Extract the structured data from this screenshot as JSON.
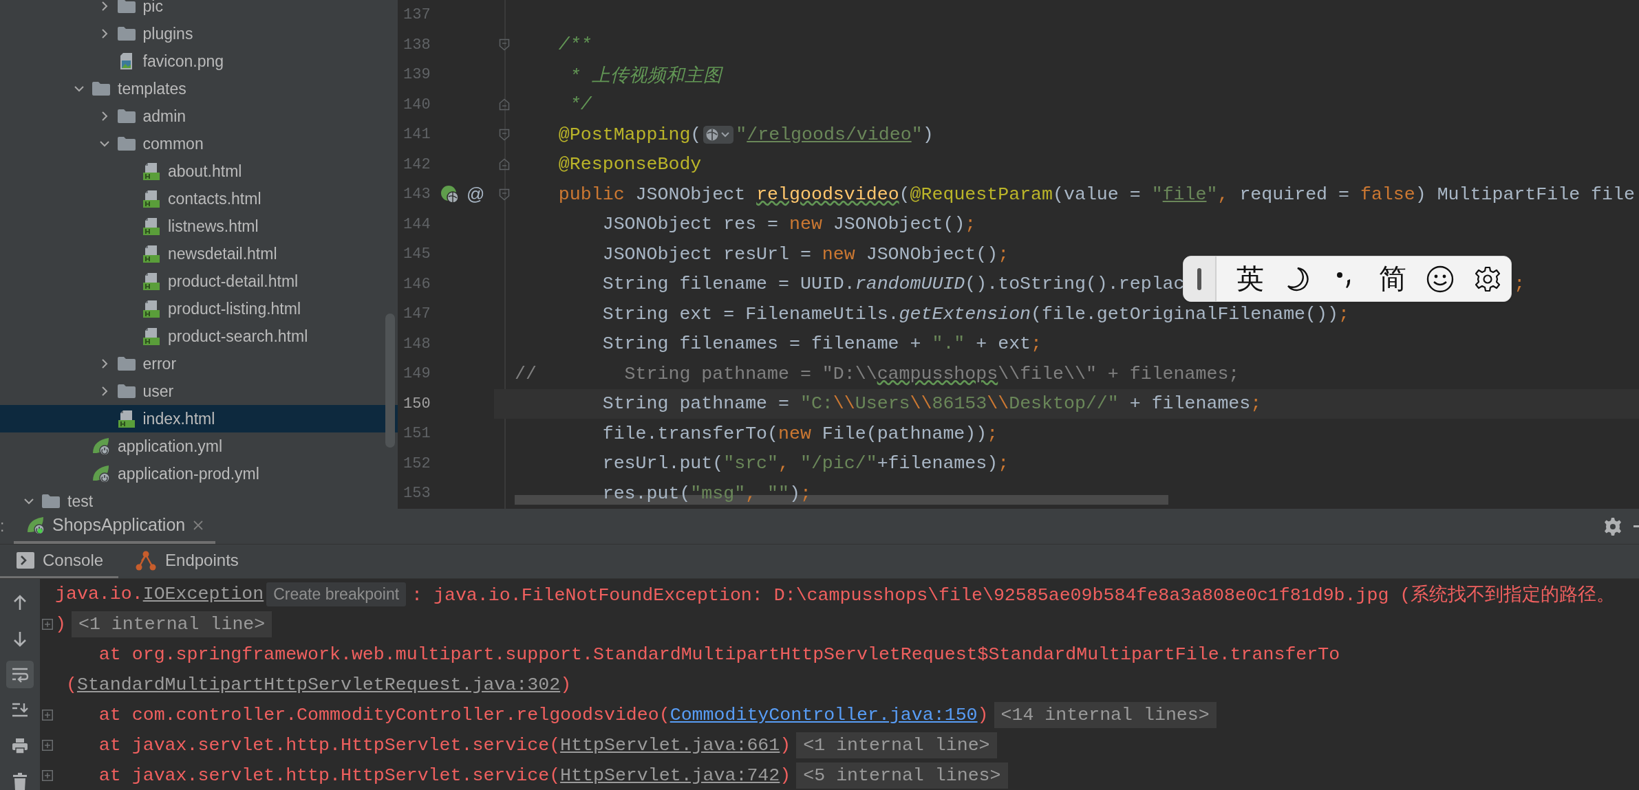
{
  "tree": {
    "items": [
      {
        "children": [
          {
            "children": [
              {
                "children": [
                  {
                    "label": "pic",
                    "kind": "folder",
                    "expanded": false,
                    "selected": false
                  },
                  {
                    "label": "plugins",
                    "kind": "folder",
                    "expanded": false,
                    "selected": false
                  },
                  {
                    "label": "favicon.png",
                    "kind": "image",
                    "selected": false
                  }
                ]
              },
              {
                "label": "templates",
                "kind": "folder",
                "expanded": true,
                "selected": false,
                "children": [
                  {
                    "label": "admin",
                    "kind": "folder",
                    "expanded": false,
                    "selected": false
                  },
                  {
                    "label": "common",
                    "kind": "folder",
                    "expanded": true,
                    "selected": false,
                    "children": [
                      {
                        "label": "about.html",
                        "kind": "html",
                        "selected": false
                      },
                      {
                        "label": "contacts.html",
                        "kind": "html",
                        "selected": false
                      },
                      {
                        "label": "listnews.html",
                        "kind": "html",
                        "selected": false
                      },
                      {
                        "label": "newsdetail.html",
                        "kind": "html",
                        "selected": false
                      },
                      {
                        "label": "product-detail.html",
                        "kind": "html",
                        "selected": false
                      },
                      {
                        "label": "product-listing.html",
                        "kind": "html",
                        "selected": false
                      },
                      {
                        "label": "product-search.html",
                        "kind": "html",
                        "selected": false
                      }
                    ]
                  },
                  {
                    "label": "error",
                    "kind": "folder",
                    "expanded": false,
                    "selected": false
                  },
                  {
                    "label": "user",
                    "kind": "folder",
                    "expanded": false,
                    "selected": false
                  },
                  {
                    "label": "index.html",
                    "kind": "html",
                    "selected": true
                  }
                ]
              },
              {
                "label": "application.yml",
                "kind": "yml",
                "selected": false
              },
              {
                "label": "application-prod.yml",
                "kind": "yml",
                "selected": false
              }
            ]
          }
        ]
      },
      {
        "label": "test",
        "kind": "folder",
        "expanded": true,
        "selected": false
      }
    ]
  },
  "editor": {
    "lines": [
      {
        "number": "137",
        "current": false
      },
      {
        "number": "138",
        "current": false,
        "fold": {
          "kind": "start"
        },
        "tokens": [
          {
            "kind": "doc",
            "text": "    /**"
          }
        ]
      },
      {
        "number": "139",
        "current": false,
        "tokens": [
          {
            "kind": "doc",
            "text": "     * 上传视频和主图"
          }
        ]
      },
      {
        "number": "140",
        "current": false,
        "fold": {
          "kind": "end"
        },
        "tokens": [
          {
            "kind": "doc",
            "text": "     */"
          }
        ]
      },
      {
        "number": "141",
        "current": false,
        "fold": {
          "kind": "start"
        },
        "tokens": [
          {
            "kind": "annotation",
            "text": "    @PostMapping"
          },
          {
            "kind": "plain",
            "text": "("
          },
          {
            "kind": "icon"
          },
          {
            "kind": "string",
            "text": "\""
          },
          {
            "kind": "string-ref",
            "text": "/relgoods/video"
          },
          {
            "kind": "string",
            "text": "\""
          },
          {
            "kind": "plain",
            "text": ")"
          }
        ]
      },
      {
        "number": "142",
        "current": false,
        "fold": {
          "kind": "end"
        },
        "tokens": [
          {
            "kind": "annotation",
            "text": "    @ResponseBody"
          }
        ]
      },
      {
        "number": "143",
        "current": false,
        "fold": {
          "kind": "start"
        },
        "markers": [
          {
            "kind": "bean"
          },
          {
            "kind": "text",
            "text": "@"
          }
        ],
        "tokens": [
          {
            "kind": "keyword",
            "text": "    public "
          },
          {
            "kind": "plain",
            "text": "JSONObject "
          },
          {
            "kind": "method",
            "text": "relgoodsvideo"
          },
          {
            "kind": "plain",
            "text": "("
          },
          {
            "kind": "annotation",
            "text": "@RequestParam"
          },
          {
            "kind": "plain",
            "text": "(value = "
          },
          {
            "kind": "string",
            "text": "\""
          },
          {
            "kind": "string-ref",
            "text": "file"
          },
          {
            "kind": "string",
            "text": "\""
          },
          {
            "kind": "keyword",
            "text": ", "
          },
          {
            "kind": "plain",
            "text": "required = "
          },
          {
            "kind": "keyword",
            "text": "false"
          },
          {
            "kind": "plain",
            "text": ") MultipartFile file"
          }
        ]
      },
      {
        "number": "144",
        "current": false,
        "tokens": [
          {
            "kind": "plain",
            "text": "        JSONObject res = "
          },
          {
            "kind": "keyword",
            "text": "new "
          },
          {
            "kind": "plain",
            "text": "JSONObject()"
          },
          {
            "kind": "keyword",
            "text": ";"
          }
        ]
      },
      {
        "number": "145",
        "current": false,
        "tokens": [
          {
            "kind": "plain",
            "text": "        JSONObject resUrl = "
          },
          {
            "kind": "keyword",
            "text": "new "
          },
          {
            "kind": "plain",
            "text": "JSONObject()"
          },
          {
            "kind": "keyword",
            "text": ";"
          }
        ]
      },
      {
        "number": "146",
        "current": false,
        "tokens": [
          {
            "kind": "plain",
            "text": "        String filename = UUID."
          },
          {
            "kind": "static",
            "text": "randomUUID"
          },
          {
            "kind": "plain",
            "text": "().toString().replac"
          },
          {
            "kind": "tail",
            "text": ";"
          }
        ]
      },
      {
        "number": "147",
        "current": false,
        "tokens": [
          {
            "kind": "plain",
            "text": "        String ext = FilenameUtils."
          },
          {
            "kind": "static",
            "text": "getExtension"
          },
          {
            "kind": "plain",
            "text": "(file.getOriginalFilename())"
          },
          {
            "kind": "keyword",
            "text": ";"
          }
        ]
      },
      {
        "number": "148",
        "current": false,
        "tokens": [
          {
            "kind": "plain",
            "text": "        String filenames = filename + "
          },
          {
            "kind": "string",
            "text": "\".\""
          },
          {
            "kind": "plain",
            "text": " + ext"
          },
          {
            "kind": "keyword",
            "text": ";"
          }
        ]
      },
      {
        "number": "149",
        "current": false,
        "tokens": [
          {
            "kind": "comment",
            "text": "//        String pathname = \"D:\\\\"
          },
          {
            "kind": "comment-typo",
            "text": "campusshops"
          },
          {
            "kind": "comment",
            "text": "\\\\file\\\\\" + filenames;"
          }
        ]
      },
      {
        "number": "150",
        "current": true,
        "tokens": [
          {
            "kind": "plain",
            "text": "        String pathname = "
          },
          {
            "kind": "string",
            "text": "\"C:"
          },
          {
            "kind": "escape",
            "text": "\\\\"
          },
          {
            "kind": "string",
            "text": "Users"
          },
          {
            "kind": "escape",
            "text": "\\\\"
          },
          {
            "kind": "string",
            "text": "86153"
          },
          {
            "kind": "escape",
            "text": "\\\\"
          },
          {
            "kind": "string",
            "text": "Desktop//\""
          },
          {
            "kind": "plain",
            "text": " + filenames"
          },
          {
            "kind": "keyword",
            "text": ";"
          }
        ]
      },
      {
        "number": "151",
        "current": false,
        "tokens": [
          {
            "kind": "plain",
            "text": "        file.transferTo("
          },
          {
            "kind": "keyword",
            "text": "new "
          },
          {
            "kind": "plain",
            "text": "File(pathname))"
          },
          {
            "kind": "keyword",
            "text": ";"
          }
        ]
      },
      {
        "number": "152",
        "current": false,
        "tokens": [
          {
            "kind": "plain",
            "text": "        resUrl.put("
          },
          {
            "kind": "string",
            "text": "\"src\""
          },
          {
            "kind": "keyword",
            "text": ", "
          },
          {
            "kind": "string",
            "text": "\"/pic/\""
          },
          {
            "kind": "plain",
            "text": "+filenames)"
          },
          {
            "kind": "keyword",
            "text": ";"
          }
        ]
      },
      {
        "number": "153",
        "current": false,
        "tokens": [
          {
            "kind": "plain",
            "text": "        res.put("
          },
          {
            "kind": "string",
            "text": "\"msg\""
          },
          {
            "kind": "keyword",
            "text": ", "
          },
          {
            "kind": "string",
            "text": "\"\""
          },
          {
            "kind": "plain",
            "text": ")"
          },
          {
            "kind": "keyword",
            "text": ";"
          }
        ]
      }
    ],
    "ime_toolbar": {
      "items": [
        {
          "kind": "grip"
        },
        {
          "kind": "text",
          "text": "英"
        },
        {
          "kind": "moon"
        },
        {
          "kind": "punctuation"
        },
        {
          "kind": "text",
          "text": "简"
        },
        {
          "kind": "smile"
        },
        {
          "kind": "gear"
        }
      ]
    }
  },
  "run_panel": {
    "label": ":",
    "tabs": [
      {
        "label": "ShopsApplication",
        "selected": true,
        "closable": true
      }
    ],
    "console_tabs": [
      {
        "label": "Console",
        "kind": "console",
        "selected": true
      },
      {
        "label": "Endpoints",
        "kind": "endpoints",
        "selected": false
      }
    ],
    "tools": [
      {
        "kind": "up",
        "on": false
      },
      {
        "kind": "down",
        "on": false
      },
      {
        "kind": "wrap",
        "on": true
      },
      {
        "kind": "scroll-end",
        "on": false
      },
      {
        "kind": "print",
        "on": false
      },
      {
        "kind": "trash",
        "on": false
      }
    ],
    "lines": [
      {
        "fold": false,
        "segments": [
          {
            "kind": "error",
            "text": "java.io."
          },
          {
            "kind": "file-link",
            "text": "IOException"
          },
          {
            "kind": "tooltip",
            "text": "Create breakpoint"
          },
          {
            "kind": "error",
            "text": ": java.io.FileNotFoundException: D:\\campusshops\\file\\92585ae09b584fe8a3a808e0c1f81d9b.jpg (系统找不到指定的路径。"
          }
        ]
      },
      {
        "fold": true,
        "segments": [
          {
            "kind": "error",
            "text": ")"
          },
          {
            "kind": "chip",
            "text": "<1 internal line>"
          }
        ]
      },
      {
        "fold": false,
        "segments": [
          {
            "kind": "error",
            "text": "    at org.springframework.web.multipart.support.StandardMultipartHttpServletRequest$StandardMultipartFile.transferTo"
          }
        ]
      },
      {
        "fold": false,
        "segments": [
          {
            "kind": "error",
            "text": " ("
          },
          {
            "kind": "file-link",
            "text": "StandardMultipartHttpServletRequest.java:302"
          },
          {
            "kind": "error",
            "text": ")"
          }
        ]
      },
      {
        "fold": true,
        "segments": [
          {
            "kind": "error",
            "text": "    at com.controller.CommodityController.relgoodsvideo("
          },
          {
            "kind": "link",
            "text": "CommodityController.java:150"
          },
          {
            "kind": "error",
            "text": ")"
          },
          {
            "kind": "chip",
            "text": "<14 internal lines>"
          }
        ]
      },
      {
        "fold": true,
        "segments": [
          {
            "kind": "error",
            "text": "    at javax.servlet.http.HttpServlet.service("
          },
          {
            "kind": "file-link",
            "text": "HttpServlet.java:661"
          },
          {
            "kind": "error",
            "text": ")"
          },
          {
            "kind": "chip",
            "text": "<1 internal line>"
          }
        ]
      },
      {
        "fold": true,
        "segments": [
          {
            "kind": "error",
            "text": "    at javax.servlet.http.HttpServlet.service("
          },
          {
            "kind": "file-link",
            "text": "HttpServlet.java:742"
          },
          {
            "kind": "error",
            "text": ")"
          },
          {
            "kind": "chip",
            "text": "<5 internal lines>"
          }
        ]
      }
    ]
  }
}
